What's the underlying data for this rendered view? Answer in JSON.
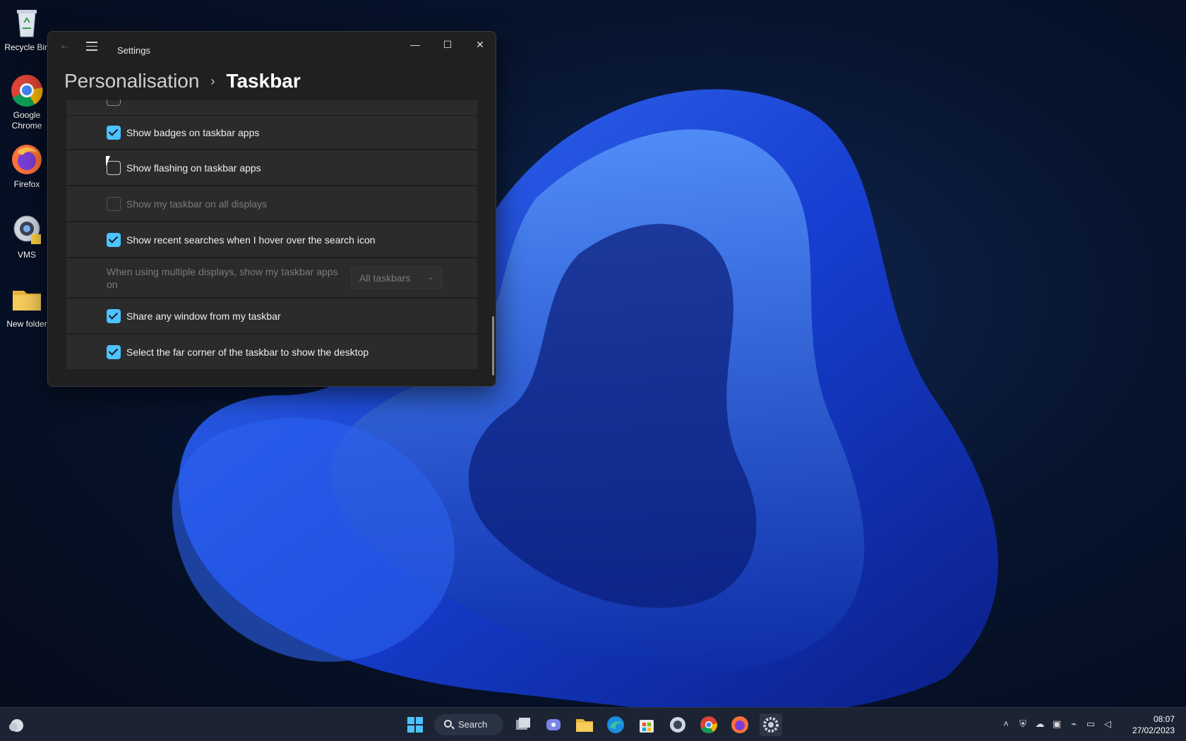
{
  "desktop": {
    "icons": [
      {
        "label": "Recycle Bin",
        "icon": "recycle-bin-icon"
      },
      {
        "label": "Google Chrome",
        "icon": "chrome-icon"
      },
      {
        "label": "Firefox",
        "icon": "firefox-icon"
      },
      {
        "label": "VMS",
        "icon": "vms-icon"
      },
      {
        "label": "New folder",
        "icon": "folder-icon"
      }
    ]
  },
  "window": {
    "title": "Settings",
    "breadcrumb": {
      "parent": "Personalisation",
      "separator": "›",
      "current": "Taskbar"
    },
    "controls": {
      "minimize": "—",
      "maximize": "☐",
      "close": "✕"
    }
  },
  "settings": {
    "rows": [
      {
        "label": "Show badges on taskbar apps",
        "checked": true
      },
      {
        "label": "Show flashing on taskbar apps",
        "checked": false
      },
      {
        "label": "Show my taskbar on all displays",
        "checked": false,
        "disabled": true
      },
      {
        "label": "Show recent searches when I hover over the search icon",
        "checked": true
      },
      {
        "label": "When using multiple displays, show my taskbar apps on",
        "dropdown_value": "All taskbars",
        "disabled": true
      },
      {
        "label": "Share any window from my taskbar",
        "checked": true
      },
      {
        "label": "Select the far corner of the taskbar to show the desktop",
        "checked": true
      }
    ]
  },
  "taskbar": {
    "search_label": "Search",
    "apps": [
      "windows-start-icon",
      "task-view-icon",
      "chat-icon",
      "file-explorer-icon",
      "edge-icon",
      "store-icon",
      "vms-icon",
      "chrome-icon",
      "firefox-icon",
      "settings-icon"
    ],
    "clock": {
      "time": "08:07",
      "date": "27/02/2023"
    }
  },
  "colors": {
    "accent": "#4cc2ff",
    "window_bg": "#202020",
    "row_bg": "#2b2b2b"
  }
}
